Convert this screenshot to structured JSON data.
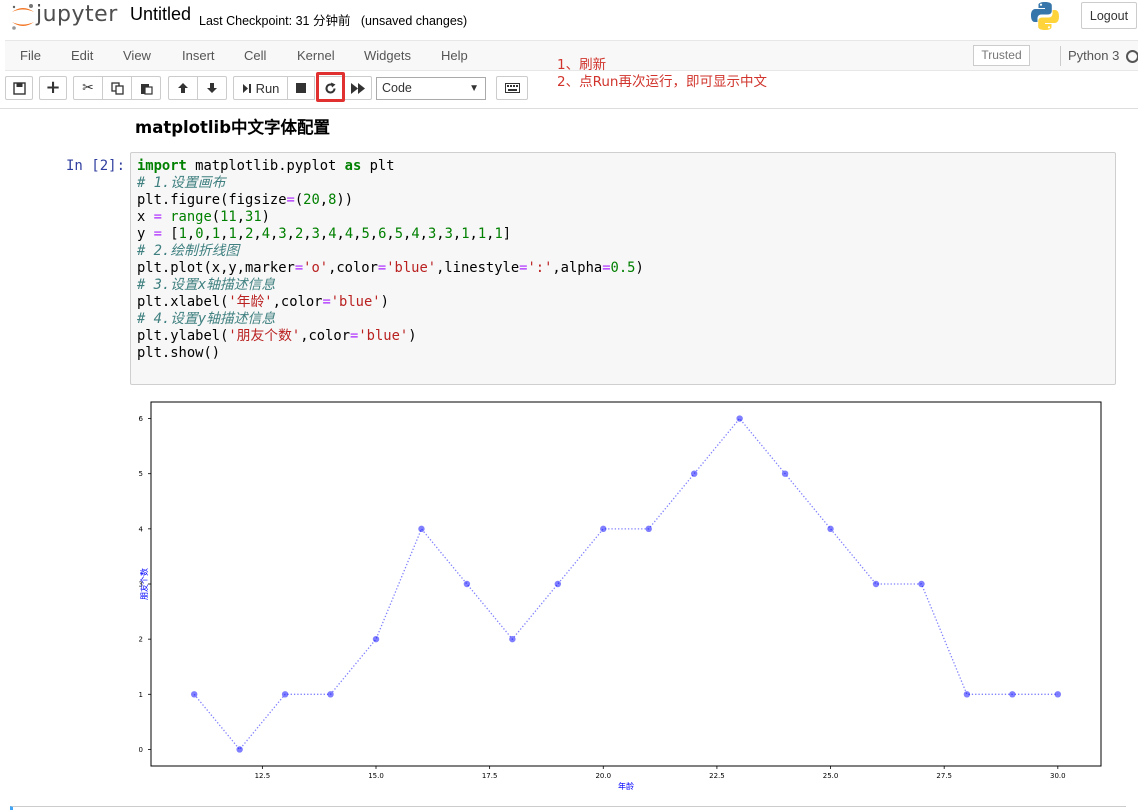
{
  "header": {
    "logo_text": "jupyter",
    "notebook_title": "Untitled",
    "checkpoint": "Last Checkpoint: 31 分钟前   (unsaved changes)",
    "logout_label": "Logout"
  },
  "menubar": {
    "items": [
      "File",
      "Edit",
      "View",
      "Insert",
      "Cell",
      "Kernel",
      "Widgets",
      "Help"
    ],
    "trusted_label": "Trusted",
    "kernel_name": "Python 3"
  },
  "toolbar": {
    "run_label": "Run",
    "cell_type": "Code"
  },
  "annotation": {
    "line1": "1、刷新",
    "line2": "2、点Run再次运行，即可显示中文"
  },
  "notebook": {
    "heading": "matplotlib中文字体配置",
    "prompt": "In [2]:"
  },
  "chart_data": {
    "type": "line",
    "x": [
      11,
      12,
      13,
      14,
      15,
      16,
      17,
      18,
      19,
      20,
      21,
      22,
      23,
      24,
      25,
      26,
      27,
      28,
      29,
      30
    ],
    "series": [
      {
        "values": [
          1,
          0,
          1,
          1,
          2,
          4,
          3,
          2,
          3,
          4,
          4,
          5,
          6,
          5,
          4,
          3,
          3,
          1,
          1,
          1
        ]
      }
    ],
    "xlabel": "年龄",
    "ylabel": "朋友个数",
    "xticks": [
      "12.5",
      "15.0",
      "17.5",
      "20.0",
      "22.5",
      "25.0",
      "27.5",
      "30.0"
    ],
    "xtick_values": [
      12.5,
      15,
      17.5,
      20,
      22.5,
      25,
      27.5,
      30
    ],
    "yticks": [
      "0",
      "1",
      "2",
      "3",
      "4",
      "5",
      "6"
    ],
    "xlim": [
      10.05,
      30.95
    ],
    "ylim": [
      -0.3,
      6.3
    ],
    "marker": "o",
    "linestyle": "dotted",
    "color": "#0000ff",
    "alpha": 0.5
  }
}
